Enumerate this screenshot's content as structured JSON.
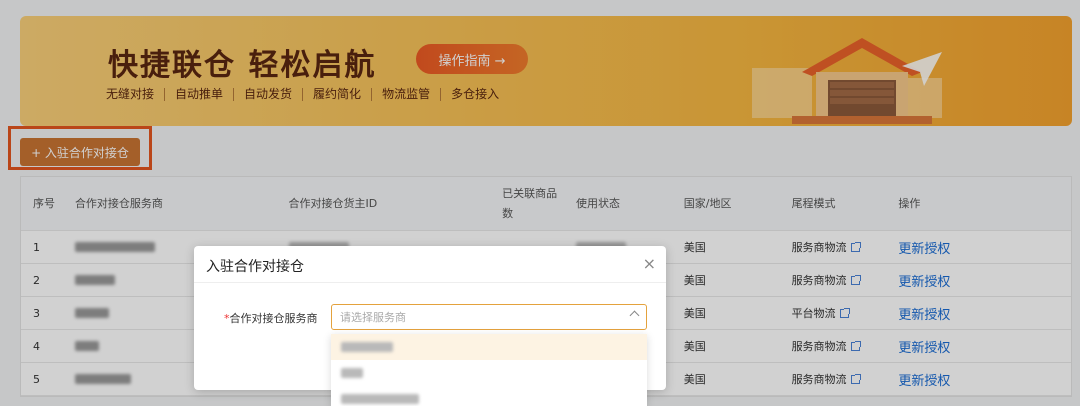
{
  "banner": {
    "title": "快捷联仓 轻松启航",
    "guide_label": "操作指南 →",
    "features": [
      "无缝对接",
      "自动推单",
      "自动发货",
      "履约简化",
      "物流监管",
      "多仓接入"
    ]
  },
  "add_button_label": "+ 入驻合作对接仓",
  "table": {
    "headers": [
      "序号",
      "合作对接仓服务商",
      "合作对接仓货主ID",
      "已关联商品数",
      "使用状态",
      "国家/地区",
      "尾程模式",
      "操作"
    ],
    "rows": [
      {
        "index": "1",
        "country": "美国",
        "mode": "服务商物流",
        "action": "更新授权"
      },
      {
        "index": "2",
        "country": "美国",
        "mode": "服务商物流",
        "action": "更新授权"
      },
      {
        "index": "3",
        "country": "美国",
        "mode": "平台物流",
        "action": "更新授权"
      },
      {
        "index": "4",
        "country": "美国",
        "mode": "服务商物流",
        "action": "更新授权"
      },
      {
        "index": "5",
        "country": "美国",
        "mode": "服务商物流",
        "action": "更新授权"
      }
    ]
  },
  "modal": {
    "title": "入驻合作对接仓",
    "close": "×",
    "field_required_mark": "*",
    "field_label": "合作对接仓服务商",
    "placeholder": "请选择服务商"
  },
  "colors": {
    "accent": "#c87433",
    "highlight": "#e3561f",
    "link": "#1a6cd4"
  }
}
